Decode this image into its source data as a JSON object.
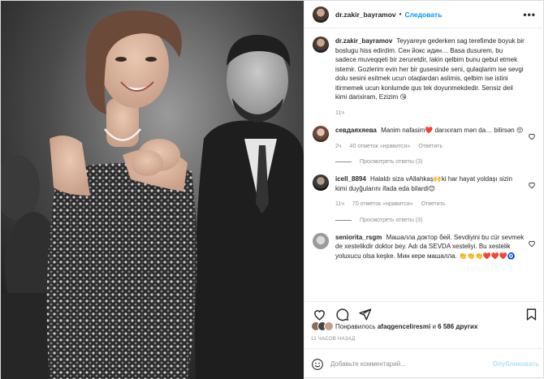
{
  "header": {
    "username": "dr.zakir_bayramov",
    "separator": "•",
    "follow_label": "Следовать",
    "more_label": "•••"
  },
  "caption": {
    "username": "dr.zakir_bayramov",
    "text": "Teyyareye gederken sag terefimde boyuk bir boslugu hiss edirdim. Сен йокс идин… Basa dusurem, bu sadece muveqqeti bir zeruretdir, lakin qelbim bunu qebul etmek istemir. Gozlerim evin her bir gusesinde seni, qulaqlarim ise sevgi dolu sesini esitmek ucun otaqlardan aslimis, qelbim ise istini itirmemek ucun konlumde qus tek doyunmekdedir. Sensiz deil kimi darixiram, Ezizim 😘",
    "time": "11ч"
  },
  "comments": [
    {
      "username": "севдаяхяева",
      "text": "Manim nafasim❤️ darıxıram mən da… bilirsən 😔",
      "time": "2ч",
      "likes": "40 отметок «нравится»",
      "reply": "Ответить",
      "replies": "Просмотреть ответы (3)"
    },
    {
      "username": "icell_8894",
      "text": "Halaldı siza vAllahkaş🙌ki har hayat yoldaşı sizin kimi duyğularını ifada eda bilardi😊",
      "time": "11ч",
      "likes": "70 отметок «нравится»",
      "reply": "Ответить",
      "replies": "Просмотреть ответы (3)"
    },
    {
      "username": "seniorita_rsgm",
      "text": "Машалла доктор бей. Sevdiyini bu cür sevmek de xestelikdir doktor bey. Adı da SEVDA xesteliyi. Bu xestelik yoluxucu olsa keşke. Мин кере машалла. 👏👏👏❤️❤️❤️🧿",
      "time": "",
      "likes": "",
      "reply": "",
      "replies": ""
    }
  ],
  "likes_line": {
    "prefix": "Понравилось",
    "user": "afaqgenceliresmi",
    "middle": "и",
    "others": "6 586 других"
  },
  "timestamp": "11 ЧАСОВ НАЗАД",
  "comment_box": {
    "placeholder": "Добавьте комментарий...",
    "publish_label": "Опубликовать"
  },
  "colors": {
    "accent": "#0095f6",
    "heart": "#ed4956",
    "muted": "#8e8e8e"
  }
}
